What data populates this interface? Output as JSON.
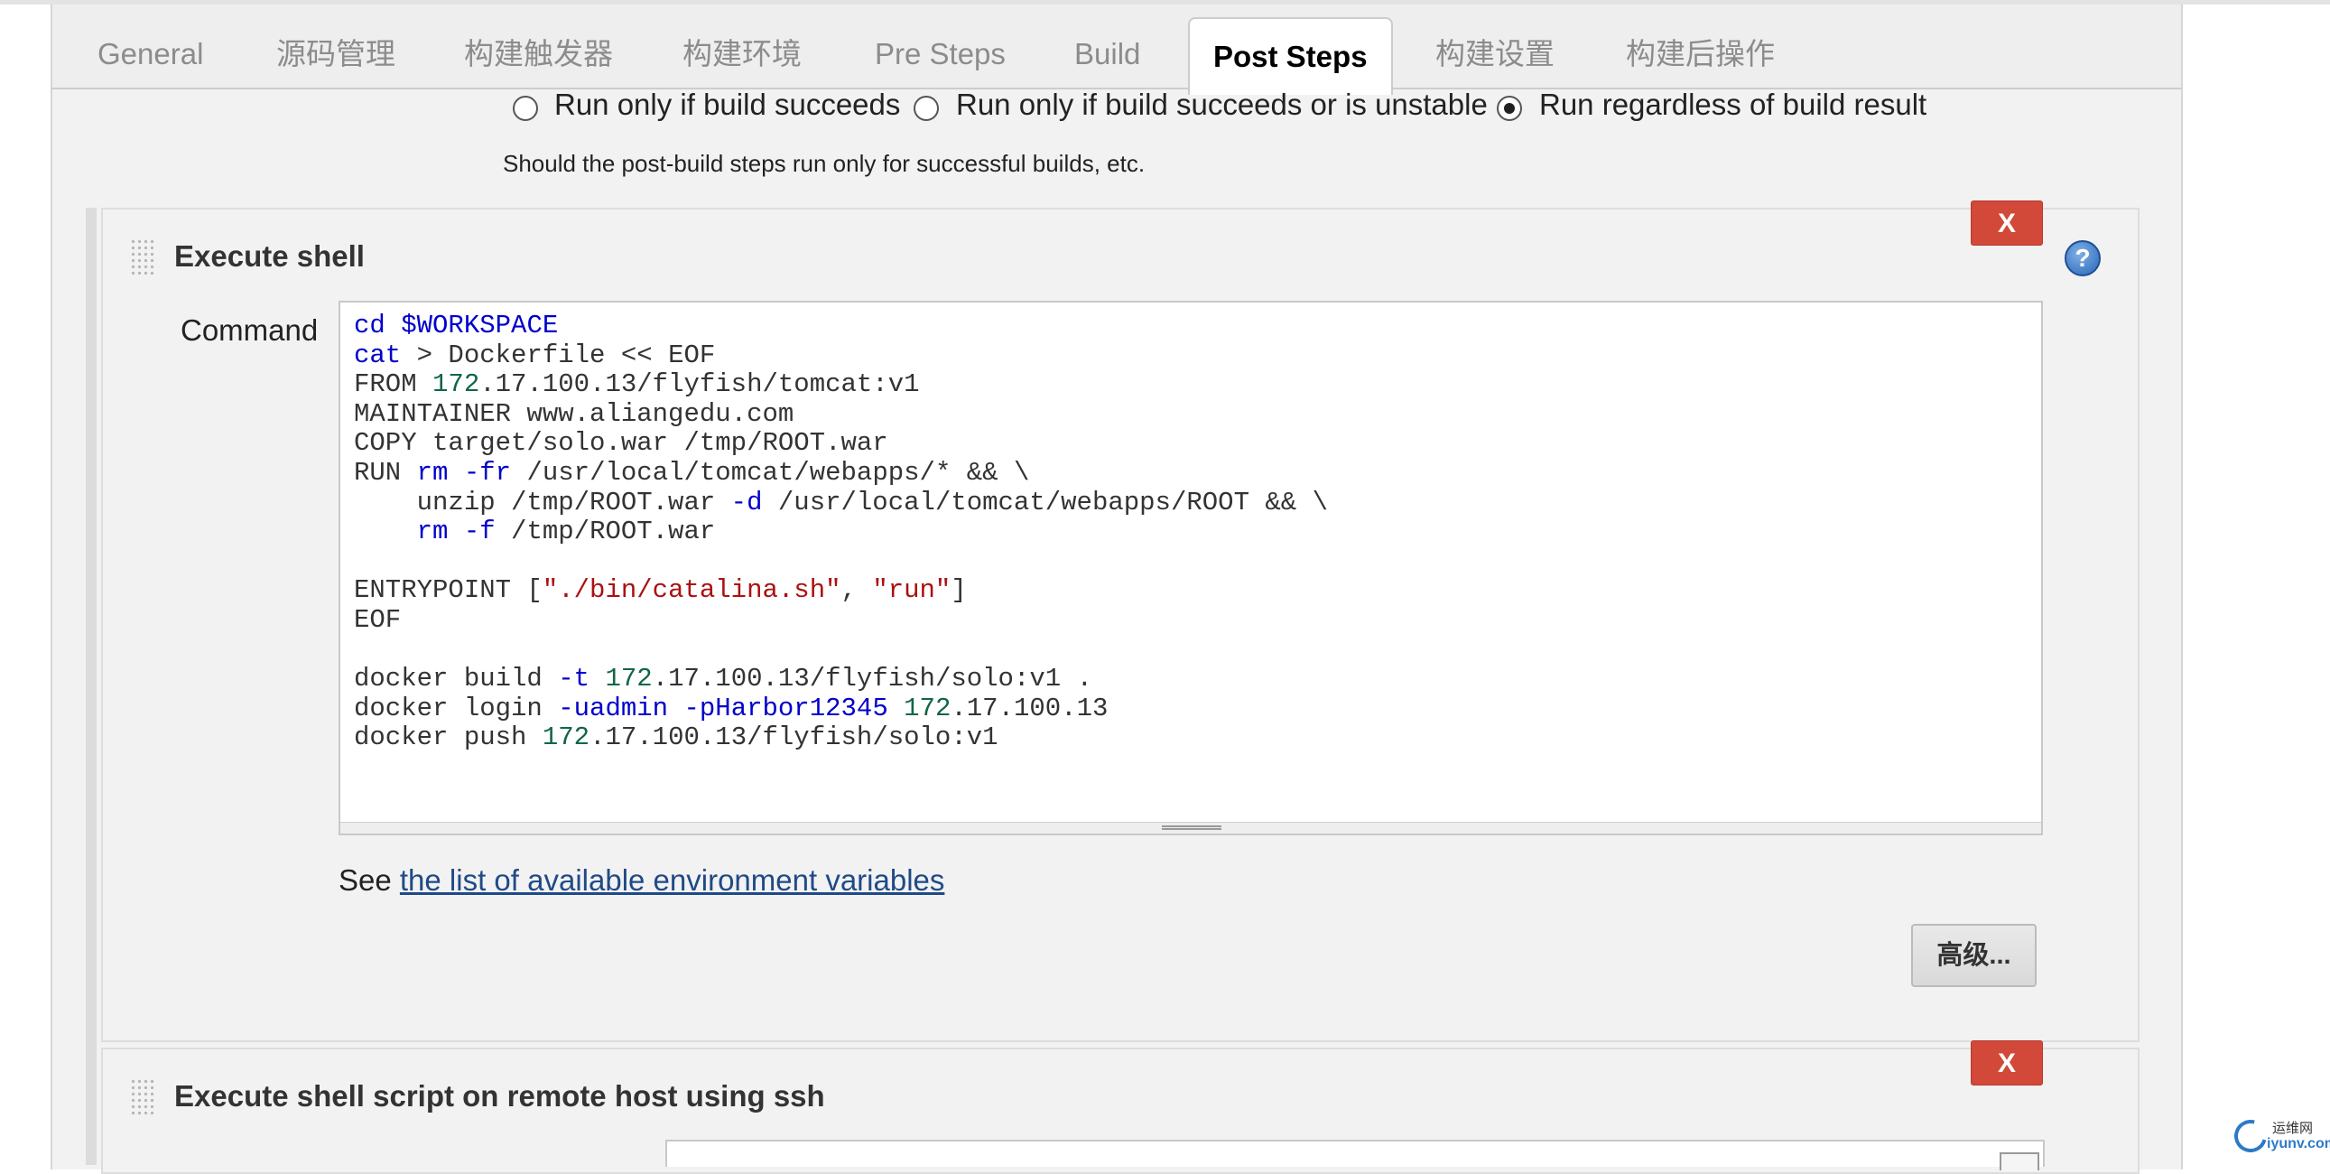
{
  "tabs": [
    {
      "label": "General",
      "active": false
    },
    {
      "label": "源码管理",
      "active": false
    },
    {
      "label": "构建触发器",
      "active": false
    },
    {
      "label": "构建环境",
      "active": false
    },
    {
      "label": "Pre Steps",
      "active": false
    },
    {
      "label": "Build",
      "active": false
    },
    {
      "label": "Post Steps",
      "active": true
    },
    {
      "label": "构建设置",
      "active": false
    },
    {
      "label": "构建后操作",
      "active": false
    }
  ],
  "post_steps": {
    "run_options": [
      {
        "label": "Run only if build succeeds",
        "checked": false
      },
      {
        "label": "Run only if build succeeds or is unstable",
        "checked": false
      },
      {
        "label": "Run regardless of build result",
        "checked": true
      }
    ],
    "hint": "Should the post-build steps run only for successful builds, etc."
  },
  "execute_shell": {
    "title": "Execute shell",
    "delete_label": "X",
    "help_label": "?",
    "command_label": "Command",
    "command_lines": [
      "cd $WORKSPACE",
      "cat > Dockerfile << EOF",
      "FROM 172.17.100.13/flyfish/tomcat:v1",
      "MAINTAINER www.aliangedu.com",
      "COPY target/solo.war /tmp/ROOT.war",
      "RUN rm -fr /usr/local/tomcat/webapps/* && \\",
      "    unzip /tmp/ROOT.war -d /usr/local/tomcat/webapps/ROOT && \\",
      "    rm -f /tmp/ROOT.war",
      "",
      "ENTRYPOINT [\"./bin/catalina.sh\", \"run\"]",
      "EOF",
      "",
      "docker build -t 172.17.100.13/flyfish/solo:v1 .",
      "docker login -uadmin -pHarbor12345 172.17.100.13",
      "docker push 172.17.100.13/flyfish/solo:v1"
    ],
    "see_prefix": "See",
    "env_link": "the list of available environment variables",
    "advanced_label": "高级..."
  },
  "remote_ssh": {
    "title": "Execute shell script on remote host using ssh",
    "delete_label": "X"
  },
  "watermark": {
    "cn": "运维网",
    "en": "iyunv.com"
  }
}
